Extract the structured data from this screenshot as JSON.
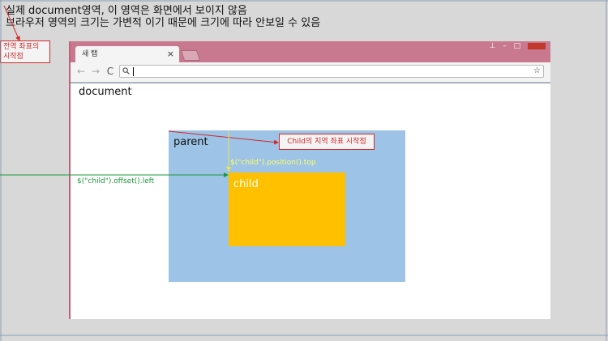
{
  "annotations": {
    "top_note_line1": "실제 document영역, 이 영역은 화면에서 보이지 않음",
    "top_note_line2": "브라우저 영역의 크기는 가변적 이기 때문에 크기에 따라 안보일 수 있음",
    "global_origin_line1": "전역 좌표의",
    "global_origin_line2": "시작점",
    "child_local_origin": "Child의 지역 좌표 시작점",
    "position_top": "$(\"child\").position().top",
    "offset_left": "$(\"child\").offset().left"
  },
  "browser": {
    "tab_title": "새 탭",
    "tab_close": "×",
    "window_controls": {
      "user": "⊥",
      "minimize": "–",
      "maximize": "□"
    },
    "nav": {
      "back": "←",
      "forward": "→",
      "reload": "C"
    },
    "omnibox": {
      "search_icon": "search-icon",
      "star_icon": "star-icon"
    }
  },
  "page": {
    "document_label": "document",
    "parent_label": "parent",
    "child_label": "child"
  },
  "colors": {
    "parent_fill": "#9dc3e6",
    "child_fill": "#ffc000",
    "annotation_red": "#d02a2a",
    "offset_green": "#1a9a3a",
    "position_yellow": "#ffff66",
    "window_frame": "#c8798f"
  }
}
